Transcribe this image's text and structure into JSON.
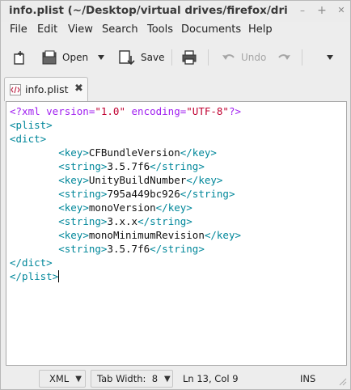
{
  "window": {
    "title": "info.plist (~/Desktop/virtual drives/firefox/dri",
    "min_glyph": "–",
    "max_glyph": "+",
    "close_glyph": "✕"
  },
  "menubar": [
    "File",
    "Edit",
    "View",
    "Search",
    "Tools",
    "Documents",
    "Help"
  ],
  "toolbar": {
    "new_icon": "new-document-icon",
    "open_label": "Open",
    "open_dropdown_icon": "dropdown-arrow-icon",
    "save_label": "Save",
    "print_icon": "printer-icon",
    "undo_label": "Undo",
    "redo_icon": "redo-icon",
    "overflow_icon": "dropdown-arrow-icon"
  },
  "tab": {
    "label": "info.plist",
    "close_glyph": "✖"
  },
  "editor": {
    "lines": [
      "<?xml version=\"1.0\" encoding=\"UTF-8\"?>",
      "<plist>",
      "<dict>",
      "        <key>CFBundleVersion</key>",
      "        <string>3.5.7f6</string>",
      "        <key>UnityBuildNumber</key>",
      "        <string>795a449bc926</string>",
      "        <key>monoVersion</key>",
      "        <string>3.x.x</string>",
      "        <key>monoMinimumRevision</key>",
      "        <string>3.5.7f6</string>",
      "</dict>",
      "</plist>"
    ]
  },
  "statusbar": {
    "language": "XML",
    "tab_width": "Tab Width:  8",
    "position": "Ln 13, Col 9",
    "mode": "INS",
    "dropdown_glyph": "▼"
  },
  "colors": {
    "declaration": "#a020f0",
    "string": "#c00030",
    "tag": "#00879a"
  }
}
